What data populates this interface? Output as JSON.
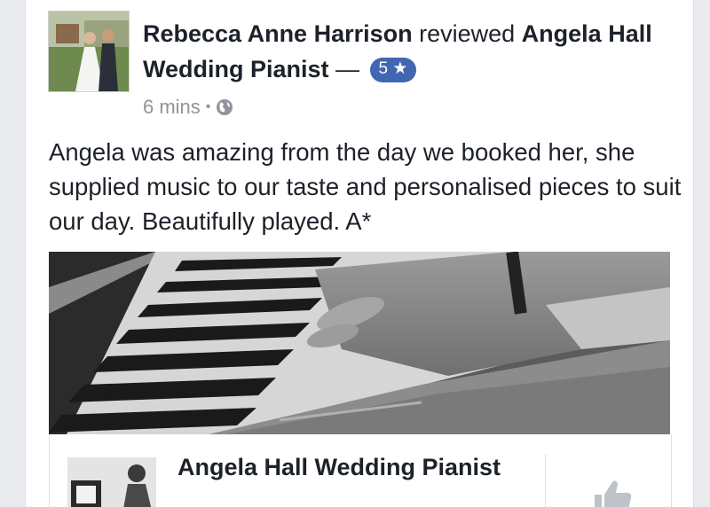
{
  "post": {
    "author": "Rebecca Anne Harrison",
    "verb": " reviewed ",
    "target": "Angela Hall Wedding Pianist",
    "dash": " — ",
    "rating_badge": "5 ★",
    "time": "6 mins",
    "dot": "•",
    "privacy_icon": "globe-icon",
    "review": "Angela was amazing from the day we booked her, she supplied music to our taste and personalised pieces to suit our day. Beautifully played. A*"
  },
  "page_preview": {
    "title": "Angela Hall Wedding Pianist",
    "like_icon": "thumbs-up-icon"
  },
  "colors": {
    "badge": "#4267b2",
    "meta": "#90949c",
    "text": "#1d2129"
  }
}
